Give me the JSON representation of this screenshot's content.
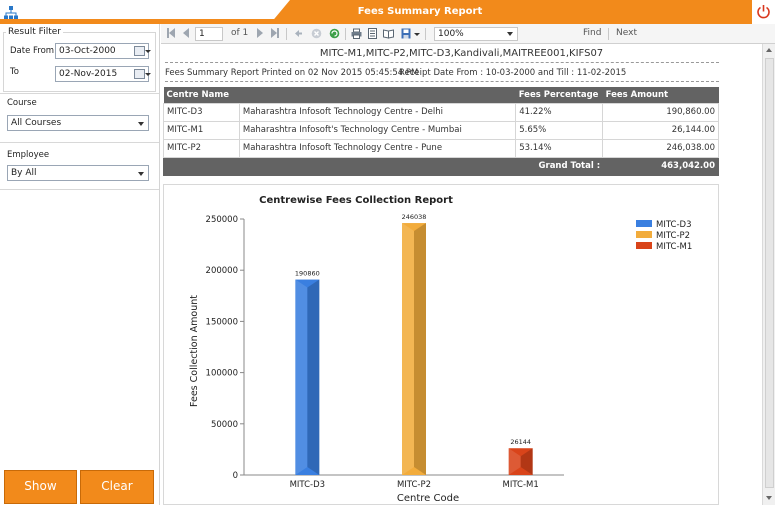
{
  "header": {
    "title": "Fees Summary Report"
  },
  "filter": {
    "group_title": "Result Filter",
    "date_from_label": "Date From",
    "date_from_value": "03-Oct-2000",
    "to_label": "To",
    "to_value": "02-Nov-2015",
    "course_label": "Course",
    "course_value": "All Courses",
    "employee_label": "Employee",
    "employee_value": "By All",
    "show_label": "Show",
    "clear_label": "Clear"
  },
  "toolbar": {
    "page_value": "1",
    "page_of": "of 1",
    "zoom": "100%",
    "find_label": "Find",
    "next_label": "Next"
  },
  "report": {
    "centres_line": "MITC-M1,MITC-P2,MITC-D3,Kandivali,MAITREE001,KIFS07",
    "printed_on": "Fees Summary Report Printed on  02 Nov 2015 05:45:54 PM",
    "receipt_range": "Receipt Date From : 10-03-2000 and Till : 11-02-2015",
    "columns": [
      "Centre Name",
      "",
      "Fees Percentage",
      "Fees Amount"
    ],
    "rows": [
      {
        "code": "MITC-D3",
        "name": "Maharashtra Infosoft Technology Centre - Delhi",
        "pct": "41.22%",
        "amount": "190,860.00"
      },
      {
        "code": "MITC-M1",
        "name": "Maharashtra Infosoft's Technology Centre - Mumbai",
        "pct": "5.65%",
        "amount": "26,144.00"
      },
      {
        "code": "MITC-P2",
        "name": "Maharashtra Infosoft Technology Centre - Pune",
        "pct": "53.14%",
        "amount": "246,038.00"
      }
    ],
    "grand_total_label": "Grand Total :",
    "grand_total_value": "463,042.00"
  },
  "colors": {
    "accent": "#f28a1b",
    "table_header": "#636363"
  },
  "chart_data": {
    "type": "bar",
    "title": "Centrewise Fees Collection Report",
    "xlabel": "Centre Code",
    "ylabel": "Fees Collection Amount",
    "categories": [
      "MITC-D3",
      "MITC-P2",
      "MITC-M1"
    ],
    "values": [
      190860,
      246038,
      26144
    ],
    "data_labels": [
      "190860",
      "246038",
      "26144"
    ],
    "colors": [
      "#3a7fe0",
      "#f2ac3c",
      "#d9441a"
    ],
    "ylim": [
      0,
      250000
    ],
    "yticks": [
      0,
      50000,
      100000,
      150000,
      200000,
      250000
    ],
    "ytick_labels": [
      "0",
      "50000",
      "100000",
      "150000",
      "200000",
      "250000"
    ],
    "legend": [
      "MITC-D3",
      "MITC-P2",
      "MITC-M1"
    ],
    "legend_position": "top-right",
    "grid": false
  }
}
